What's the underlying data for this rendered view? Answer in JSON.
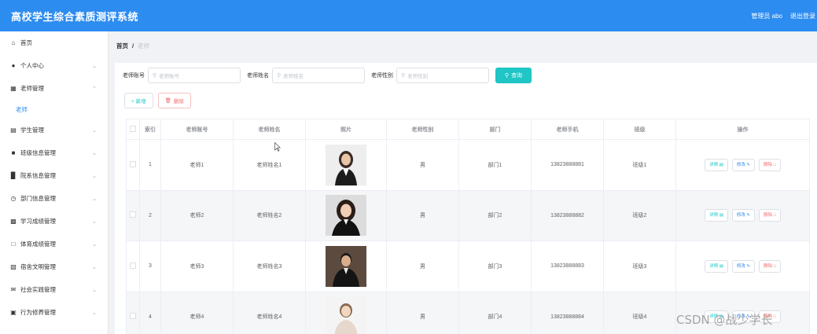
{
  "header": {
    "app_title": "高校学生综合素质测评系统",
    "user_label": "管理员 abo",
    "logout_label": "退出登录"
  },
  "sidebar": {
    "items": [
      {
        "label": "首页",
        "icon": "home-icon",
        "expandable": false
      },
      {
        "label": "个人中心",
        "icon": "user-icon",
        "expandable": true
      },
      {
        "label": "老师管理",
        "icon": "grid-icon",
        "expandable": true,
        "expanded": true
      },
      {
        "label": "学生管理",
        "icon": "bank-icon",
        "expandable": true
      },
      {
        "label": "班级信息管理",
        "icon": "building-icon",
        "expandable": true
      },
      {
        "label": "院系信息管理",
        "icon": "bar-chart-icon",
        "expandable": true
      },
      {
        "label": "部门信息管理",
        "icon": "clock-icon",
        "expandable": true
      },
      {
        "label": "学习成绩管理",
        "icon": "apps-icon",
        "expandable": true
      },
      {
        "label": "体育成绩管理",
        "icon": "copy-icon",
        "expandable": true
      },
      {
        "label": "宿舍文明管理",
        "icon": "barcode-icon",
        "expandable": true
      },
      {
        "label": "社会实践管理",
        "icon": "mail-icon",
        "expandable": true
      },
      {
        "label": "行为修养管理",
        "icon": "ticket-icon",
        "expandable": true
      }
    ],
    "submenu": {
      "label": "老师"
    }
  },
  "breadcrumb": {
    "home": "首页",
    "separator": "/",
    "current": "老师"
  },
  "search": {
    "fields": [
      {
        "label": "老师账号",
        "placeholder": "老师账号"
      },
      {
        "label": "老师姓名",
        "placeholder": "老师姓名"
      },
      {
        "label": "老师性别",
        "placeholder": "老师性别"
      }
    ],
    "query_label": "查询"
  },
  "actions": {
    "add_label": "+ 新增",
    "delete_label": "删除"
  },
  "table": {
    "columns": [
      "",
      "索引",
      "老师账号",
      "老师姓名",
      "照片",
      "老师性别",
      "部门",
      "老师手机",
      "班级",
      "操作"
    ],
    "rows": [
      {
        "index": "1",
        "account": "老师1",
        "name": "老师姓名1",
        "gender": "男",
        "dept": "部门1",
        "phone": "13823888881",
        "class": "班级1"
      },
      {
        "index": "2",
        "account": "老师2",
        "name": "老师姓名2",
        "gender": "男",
        "dept": "部门2",
        "phone": "13823888882",
        "class": "班级2"
      },
      {
        "index": "3",
        "account": "老师3",
        "name": "老师姓名3",
        "gender": "男",
        "dept": "部门3",
        "phone": "13823888883",
        "class": "班级3"
      },
      {
        "index": "4",
        "account": "老师4",
        "name": "老师姓名4",
        "gender": "男",
        "dept": "部门4",
        "phone": "13823888884",
        "class": "班级4"
      }
    ],
    "op_labels": {
      "detail": "详情",
      "edit": "修改",
      "delete": "删除"
    }
  },
  "watermark": "CSDN @战少学长",
  "colors": {
    "primary": "#2d8cf0",
    "accent_teal": "#20c5c5",
    "danger": "#f56c6c"
  }
}
